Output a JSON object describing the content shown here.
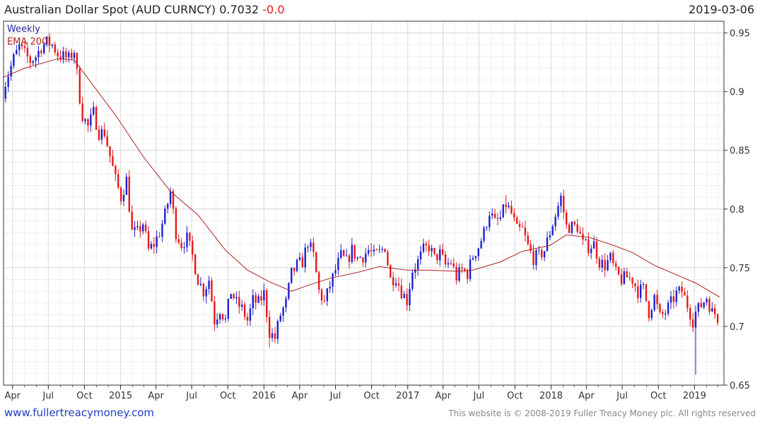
{
  "header": {
    "title": "Australian Dollar Spot (AUD CURNCY)",
    "last_price": "0.7032",
    "change": "-0.0",
    "date": "2019-03-06"
  },
  "footer": {
    "website": "www.fullertreacymoney.com",
    "copyright": "This website is © 2008-2019 Fuller Treacy Money plc. All rights reserved"
  },
  "colors": {
    "up": "#1f1fd0",
    "down": "#e8181c",
    "ema": "#b02020",
    "grid": "#e6e6e6",
    "frame": "#333333"
  },
  "chart_data": {
    "type": "candlestick",
    "frequency_label": "Weekly",
    "indicator_label": "EMA 200",
    "ylim": [
      0.65,
      0.96
    ],
    "y_ticks": [
      0.65,
      0.7,
      0.75,
      0.8,
      0.85,
      0.9,
      0.95
    ],
    "x_ticks": [
      {
        "label": "Apr",
        "date": "2014-04-01"
      },
      {
        "label": "Jul",
        "date": "2014-07-01"
      },
      {
        "label": "Oct",
        "date": "2014-10-01"
      },
      {
        "label": "2015",
        "date": "2015-01-01"
      },
      {
        "label": "Apr",
        "date": "2015-04-01"
      },
      {
        "label": "Jul",
        "date": "2015-07-01"
      },
      {
        "label": "Oct",
        "date": "2015-10-01"
      },
      {
        "label": "2016",
        "date": "2016-01-01"
      },
      {
        "label": "Apr",
        "date": "2016-04-01"
      },
      {
        "label": "Jul",
        "date": "2016-07-01"
      },
      {
        "label": "Oct",
        "date": "2016-10-01"
      },
      {
        "label": "2017",
        "date": "2017-01-01"
      },
      {
        "label": "Apr",
        "date": "2017-04-01"
      },
      {
        "label": "Jul",
        "date": "2017-07-01"
      },
      {
        "label": "Oct",
        "date": "2017-10-01"
      },
      {
        "label": "2018",
        "date": "2018-01-01"
      },
      {
        "label": "Apr",
        "date": "2018-04-01"
      },
      {
        "label": "Jul",
        "date": "2018-07-01"
      },
      {
        "label": "Oct",
        "date": "2018-10-01"
      },
      {
        "label": "2019",
        "date": "2019-01-01"
      }
    ],
    "x_range": [
      "2014-03-09",
      "2019-03-17"
    ],
    "close_path": [
      [
        "2014-03-07",
        0.9
      ],
      [
        "2014-03-21",
        0.915
      ],
      [
        "2014-04-04",
        0.928
      ],
      [
        "2014-04-18",
        0.938
      ],
      [
        "2014-05-02",
        0.932
      ],
      [
        "2014-05-16",
        0.926
      ],
      [
        "2014-05-30",
        0.93
      ],
      [
        "2014-06-13",
        0.938
      ],
      [
        "2014-06-27",
        0.942
      ],
      [
        "2014-07-11",
        0.94
      ],
      [
        "2014-07-25",
        0.932
      ],
      [
        "2014-08-08",
        0.93
      ],
      [
        "2014-08-22",
        0.928
      ],
      [
        "2014-09-05",
        0.935
      ],
      [
        "2014-09-19",
        0.895
      ],
      [
        "2014-09-26",
        0.88
      ],
      [
        "2014-10-10",
        0.87
      ],
      [
        "2014-10-24",
        0.882
      ],
      [
        "2014-11-07",
        0.865
      ],
      [
        "2014-11-21",
        0.865
      ],
      [
        "2014-12-05",
        0.845
      ],
      [
        "2014-12-19",
        0.825
      ],
      [
        "2015-01-02",
        0.81
      ],
      [
        "2015-01-16",
        0.825
      ],
      [
        "2015-01-30",
        0.78
      ],
      [
        "2015-02-13",
        0.78
      ],
      [
        "2015-02-27",
        0.788
      ],
      [
        "2015-03-13",
        0.765
      ],
      [
        "2015-03-27",
        0.77
      ],
      [
        "2015-04-10",
        0.78
      ],
      [
        "2015-04-24",
        0.795
      ],
      [
        "2015-05-08",
        0.815
      ],
      [
        "2015-05-22",
        0.78
      ],
      [
        "2015-06-05",
        0.77
      ],
      [
        "2015-06-19",
        0.775
      ],
      [
        "2015-07-03",
        0.76
      ],
      [
        "2015-07-17",
        0.74
      ],
      [
        "2015-07-31",
        0.73
      ],
      [
        "2015-08-14",
        0.74
      ],
      [
        "2015-08-28",
        0.705
      ],
      [
        "2015-09-11",
        0.715
      ],
      [
        "2015-09-25",
        0.705
      ],
      [
        "2015-10-09",
        0.73
      ],
      [
        "2015-10-23",
        0.72
      ],
      [
        "2015-11-06",
        0.715
      ],
      [
        "2015-11-20",
        0.705
      ],
      [
        "2015-12-04",
        0.722
      ],
      [
        "2015-12-18",
        0.72
      ],
      [
        "2016-01-01",
        0.728
      ],
      [
        "2016-01-15",
        0.695
      ],
      [
        "2016-01-29",
        0.69
      ],
      [
        "2016-02-12",
        0.71
      ],
      [
        "2016-02-26",
        0.72
      ],
      [
        "2016-03-11",
        0.745
      ],
      [
        "2016-03-25",
        0.752
      ],
      [
        "2016-04-08",
        0.755
      ],
      [
        "2016-04-22",
        0.772
      ],
      [
        "2016-05-06",
        0.76
      ],
      [
        "2016-05-20",
        0.73
      ],
      [
        "2016-06-03",
        0.72
      ],
      [
        "2016-06-17",
        0.735
      ],
      [
        "2016-07-01",
        0.748
      ],
      [
        "2016-07-15",
        0.76
      ],
      [
        "2016-07-29",
        0.755
      ],
      [
        "2016-08-12",
        0.765
      ],
      [
        "2016-08-26",
        0.758
      ],
      [
        "2016-09-09",
        0.76
      ],
      [
        "2016-09-23",
        0.765
      ],
      [
        "2016-10-07",
        0.76
      ],
      [
        "2016-10-21",
        0.763
      ],
      [
        "2016-11-04",
        0.768
      ],
      [
        "2016-11-18",
        0.74
      ],
      [
        "2016-12-02",
        0.742
      ],
      [
        "2016-12-16",
        0.73
      ],
      [
        "2016-12-30",
        0.722
      ],
      [
        "2017-01-13",
        0.748
      ],
      [
        "2017-01-27",
        0.755
      ],
      [
        "2017-02-10",
        0.765
      ],
      [
        "2017-02-24",
        0.768
      ],
      [
        "2017-03-10",
        0.758
      ],
      [
        "2017-03-24",
        0.762
      ],
      [
        "2017-04-07",
        0.752
      ],
      [
        "2017-04-21",
        0.755
      ],
      [
        "2017-05-05",
        0.742
      ],
      [
        "2017-05-19",
        0.748
      ],
      [
        "2017-06-02",
        0.745
      ],
      [
        "2017-06-16",
        0.76
      ],
      [
        "2017-06-30",
        0.768
      ],
      [
        "2017-07-14",
        0.78
      ],
      [
        "2017-07-28",
        0.798
      ],
      [
        "2017-08-11",
        0.788
      ],
      [
        "2017-08-25",
        0.792
      ],
      [
        "2017-09-08",
        0.804
      ],
      [
        "2017-09-22",
        0.796
      ],
      [
        "2017-10-06",
        0.782
      ],
      [
        "2017-10-20",
        0.782
      ],
      [
        "2017-11-03",
        0.768
      ],
      [
        "2017-11-17",
        0.758
      ],
      [
        "2017-12-01",
        0.76
      ],
      [
        "2017-12-15",
        0.765
      ],
      [
        "2017-12-29",
        0.78
      ],
      [
        "2018-01-12",
        0.795
      ],
      [
        "2018-01-26",
        0.81
      ],
      [
        "2018-02-09",
        0.785
      ],
      [
        "2018-02-23",
        0.785
      ],
      [
        "2018-03-09",
        0.785
      ],
      [
        "2018-03-23",
        0.77
      ],
      [
        "2018-04-06",
        0.768
      ],
      [
        "2018-04-20",
        0.77
      ],
      [
        "2018-05-04",
        0.755
      ],
      [
        "2018-05-18",
        0.752
      ],
      [
        "2018-06-01",
        0.758
      ],
      [
        "2018-06-15",
        0.745
      ],
      [
        "2018-06-29",
        0.74
      ],
      [
        "2018-07-13",
        0.742
      ],
      [
        "2018-07-27",
        0.74
      ],
      [
        "2018-08-10",
        0.73
      ],
      [
        "2018-08-24",
        0.732
      ],
      [
        "2018-09-07",
        0.712
      ],
      [
        "2018-09-21",
        0.725
      ],
      [
        "2018-10-05",
        0.708
      ],
      [
        "2018-10-19",
        0.712
      ],
      [
        "2018-11-02",
        0.72
      ],
      [
        "2018-11-16",
        0.728
      ],
      [
        "2018-11-30",
        0.73
      ],
      [
        "2018-12-14",
        0.718
      ],
      [
        "2018-12-28",
        0.705
      ],
      [
        "2019-01-04",
        0.712
      ],
      [
        "2019-01-18",
        0.718
      ],
      [
        "2019-02-01",
        0.725
      ],
      [
        "2019-02-15",
        0.712
      ],
      [
        "2019-03-01",
        0.71
      ],
      [
        "2019-03-06",
        0.7032
      ]
    ],
    "ema_200": [
      [
        "2014-03-07",
        0.912
      ],
      [
        "2014-05-02",
        0.92
      ],
      [
        "2014-07-25",
        0.928
      ],
      [
        "2014-09-05",
        0.927
      ],
      [
        "2014-10-24",
        0.905
      ],
      [
        "2014-12-19",
        0.88
      ],
      [
        "2015-02-27",
        0.845
      ],
      [
        "2015-05-08",
        0.815
      ],
      [
        "2015-07-17",
        0.795
      ],
      [
        "2015-09-25",
        0.765
      ],
      [
        "2015-11-20",
        0.748
      ],
      [
        "2016-01-15",
        0.738
      ],
      [
        "2016-03-11",
        0.73
      ],
      [
        "2016-04-22",
        0.735
      ],
      [
        "2016-06-17",
        0.741
      ],
      [
        "2016-08-26",
        0.746
      ],
      [
        "2016-10-21",
        0.751
      ],
      [
        "2016-12-30",
        0.748
      ],
      [
        "2017-02-24",
        0.748
      ],
      [
        "2017-05-05",
        0.747
      ],
      [
        "2017-06-16",
        0.748
      ],
      [
        "2017-08-25",
        0.755
      ],
      [
        "2017-10-20",
        0.764
      ],
      [
        "2017-12-29",
        0.769
      ],
      [
        "2018-02-09",
        0.778
      ],
      [
        "2018-04-06",
        0.776
      ],
      [
        "2018-06-01",
        0.77
      ],
      [
        "2018-07-27",
        0.763
      ],
      [
        "2018-09-21",
        0.752
      ],
      [
        "2018-11-30",
        0.742
      ],
      [
        "2019-01-04",
        0.737
      ],
      [
        "2019-03-06",
        0.725
      ]
    ],
    "notable_spikes": [
      {
        "date": "2014-03-07",
        "low": 0.892
      },
      {
        "date": "2014-07-04",
        "high": 0.95
      },
      {
        "date": "2016-01-15",
        "low": 0.682
      },
      {
        "date": "2017-09-08",
        "high": 0.812
      },
      {
        "date": "2018-01-26",
        "high": 0.814
      },
      {
        "date": "2019-01-04",
        "low": 0.659
      }
    ]
  }
}
